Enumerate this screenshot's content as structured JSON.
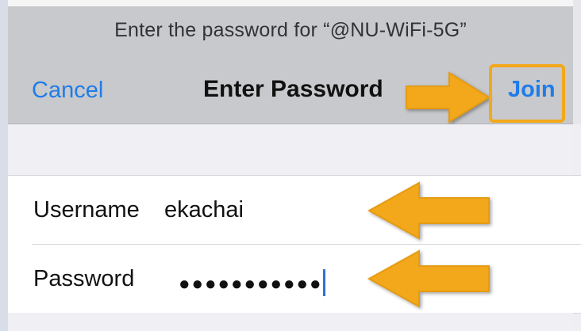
{
  "header": {
    "prompt": "Enter the password for “@NU-WiFi-5G”",
    "cancel_label": "Cancel",
    "title": "Enter Password",
    "join_label": "Join"
  },
  "form": {
    "username_label": "Username",
    "username_value": "ekachai",
    "password_label": "Password",
    "password_value": "●●●●●●●●●●●"
  },
  "annotations": {
    "arrow_color": "#f2a81a",
    "highlight_color": "#f2a81a"
  },
  "colors": {
    "accent": "#1f7ce8",
    "header_background": "#c8c9cc",
    "grouped_background": "#efeff4",
    "cell_background": "#ffffff"
  }
}
